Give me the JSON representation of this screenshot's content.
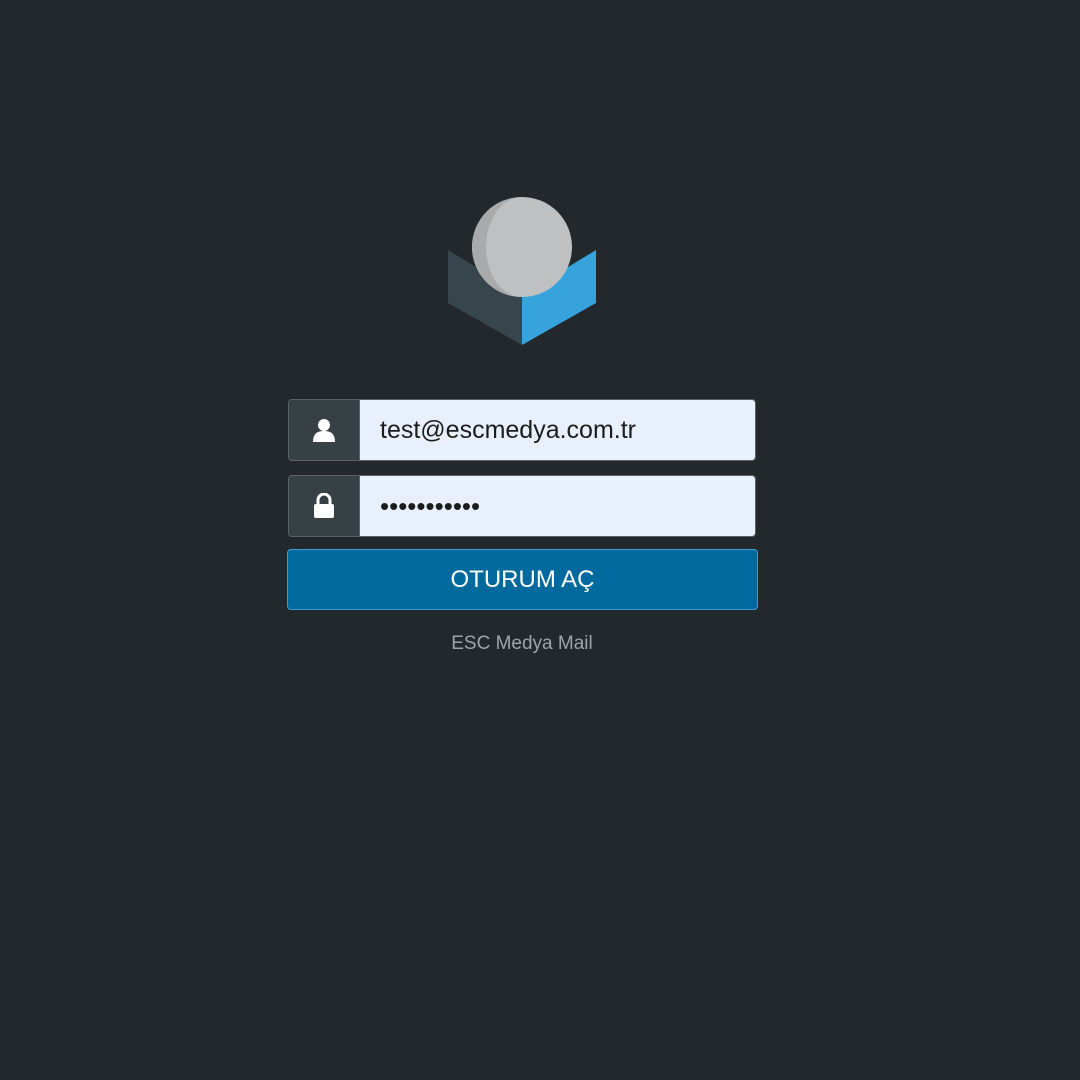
{
  "login": {
    "username": {
      "icon": "user-icon",
      "value": "test@escmedya.com.tr"
    },
    "password": {
      "icon": "lock-icon",
      "value": "•••••••••••"
    },
    "submit_label": "OTURUM AÇ"
  },
  "footer": {
    "product_name": "ESC Medya Mail"
  },
  "logo": {
    "icon": "roundcube-logo",
    "colors": {
      "box_dark": "#37454c",
      "box_blue": "#37a3dc",
      "sphere": "#bfc0c2"
    }
  },
  "colors": {
    "background": "#22282c",
    "input_bg": "#e8f0fd",
    "addon_bg": "#374145",
    "button_bg": "#006a9e",
    "footer_text": "#9aa6ab"
  }
}
